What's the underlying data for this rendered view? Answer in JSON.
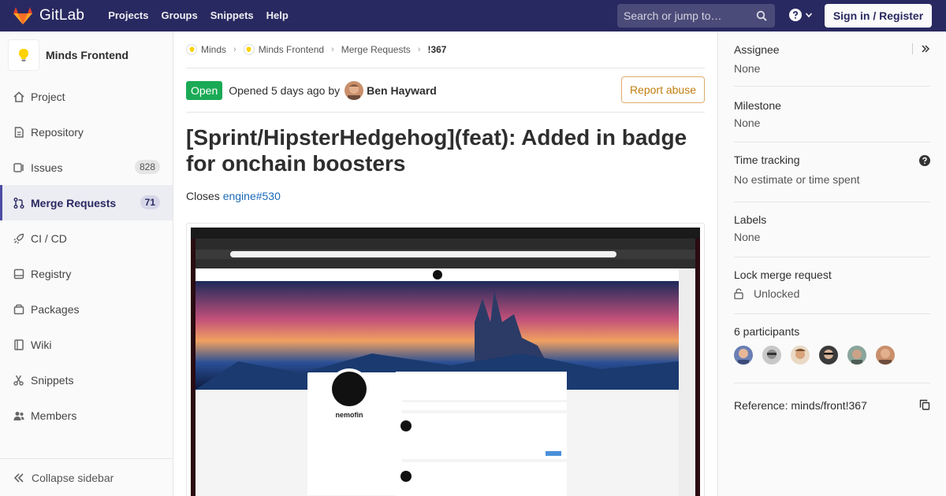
{
  "navbar": {
    "brand": "GitLab",
    "links": [
      "Projects",
      "Groups",
      "Snippets",
      "Help"
    ],
    "search_placeholder": "Search or jump to…",
    "signin": "Sign in / Register"
  },
  "sidebar": {
    "project_name": "Minds Frontend",
    "items": [
      {
        "label": "Project",
        "icon": "home-icon"
      },
      {
        "label": "Repository",
        "icon": "doc-icon"
      },
      {
        "label": "Issues",
        "icon": "issues-icon",
        "count": "828"
      },
      {
        "label": "Merge Requests",
        "icon": "merge-request-icon",
        "count": "71",
        "active": true
      },
      {
        "label": "CI / CD",
        "icon": "rocket-icon"
      },
      {
        "label": "Registry",
        "icon": "disk-icon"
      },
      {
        "label": "Packages",
        "icon": "package-icon"
      },
      {
        "label": "Wiki",
        "icon": "book-icon"
      },
      {
        "label": "Snippets",
        "icon": "scissors-icon"
      },
      {
        "label": "Members",
        "icon": "users-icon"
      }
    ],
    "collapse_label": "Collapse sidebar"
  },
  "breadcrumb": {
    "group": "Minds",
    "project": "Minds Frontend",
    "section": "Merge Requests",
    "current": "!367"
  },
  "mr": {
    "state": "Open",
    "opened_text": "Opened 5 days ago by",
    "author": "Ben Hayward",
    "report_label": "Report abuse",
    "title": "[Sprint/HipsterHedgehog](feat): Added in badge for onchain boosters",
    "closes_prefix": "Closes",
    "closes_link": "engine#530"
  },
  "right_sidebar": {
    "assignee_title": "Assignee",
    "assignee_value": "None",
    "milestone_title": "Milestone",
    "milestone_value": "None",
    "time_title": "Time tracking",
    "time_value": "No estimate or time spent",
    "labels_title": "Labels",
    "labels_value": "None",
    "lock_title": "Lock merge request",
    "lock_value": "Unlocked",
    "participants_title": "6 participants",
    "reference": "Reference: minds/front!367"
  },
  "colors": {
    "navbar": "#292961",
    "open_badge": "#1aaa55",
    "link": "#1b69b6",
    "report_border": "#e0ac6d"
  },
  "screenshot": {
    "profile_name": "nemofin"
  }
}
